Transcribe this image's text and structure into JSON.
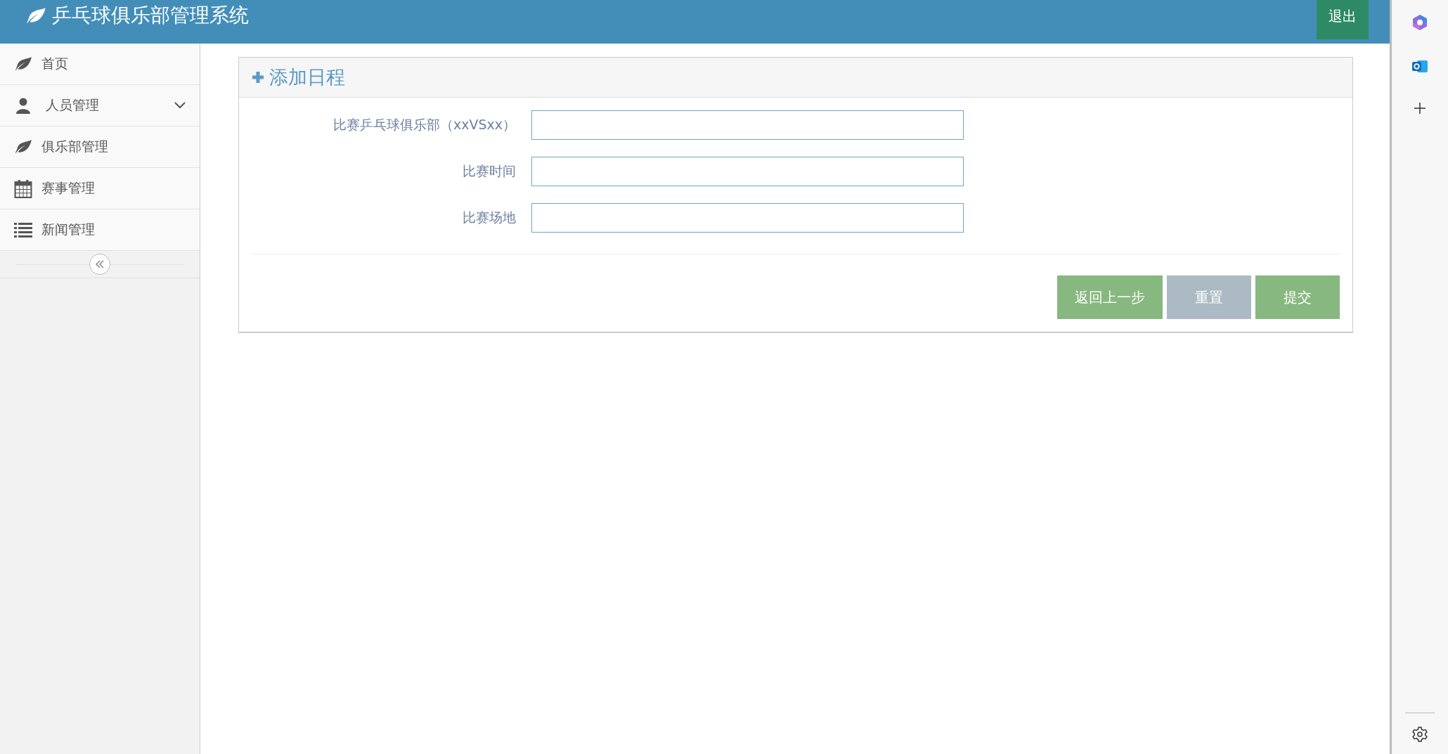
{
  "header": {
    "title": "乒乓球俱乐部管理系统",
    "logout": "退出"
  },
  "sidebar": {
    "items": [
      {
        "label": "首页",
        "kind": "link"
      },
      {
        "label": "人员管理",
        "kind": "submenu",
        "expanded": false
      },
      {
        "label": "俱乐部管理",
        "kind": "link"
      },
      {
        "label": "赛事管理",
        "kind": "link"
      },
      {
        "label": "新闻管理",
        "kind": "link"
      }
    ]
  },
  "panel": {
    "title": "添加日程",
    "fields": [
      {
        "label": "比赛乒乓球俱乐部（xxVSxx）"
      },
      {
        "label": "比赛时间"
      },
      {
        "label": "比赛场地"
      }
    ],
    "buttons": [
      {
        "label": "返回上一步",
        "kind": "primary"
      },
      {
        "label": "重置",
        "kind": "secondary"
      },
      {
        "label": "提交",
        "kind": "primary"
      }
    ]
  }
}
